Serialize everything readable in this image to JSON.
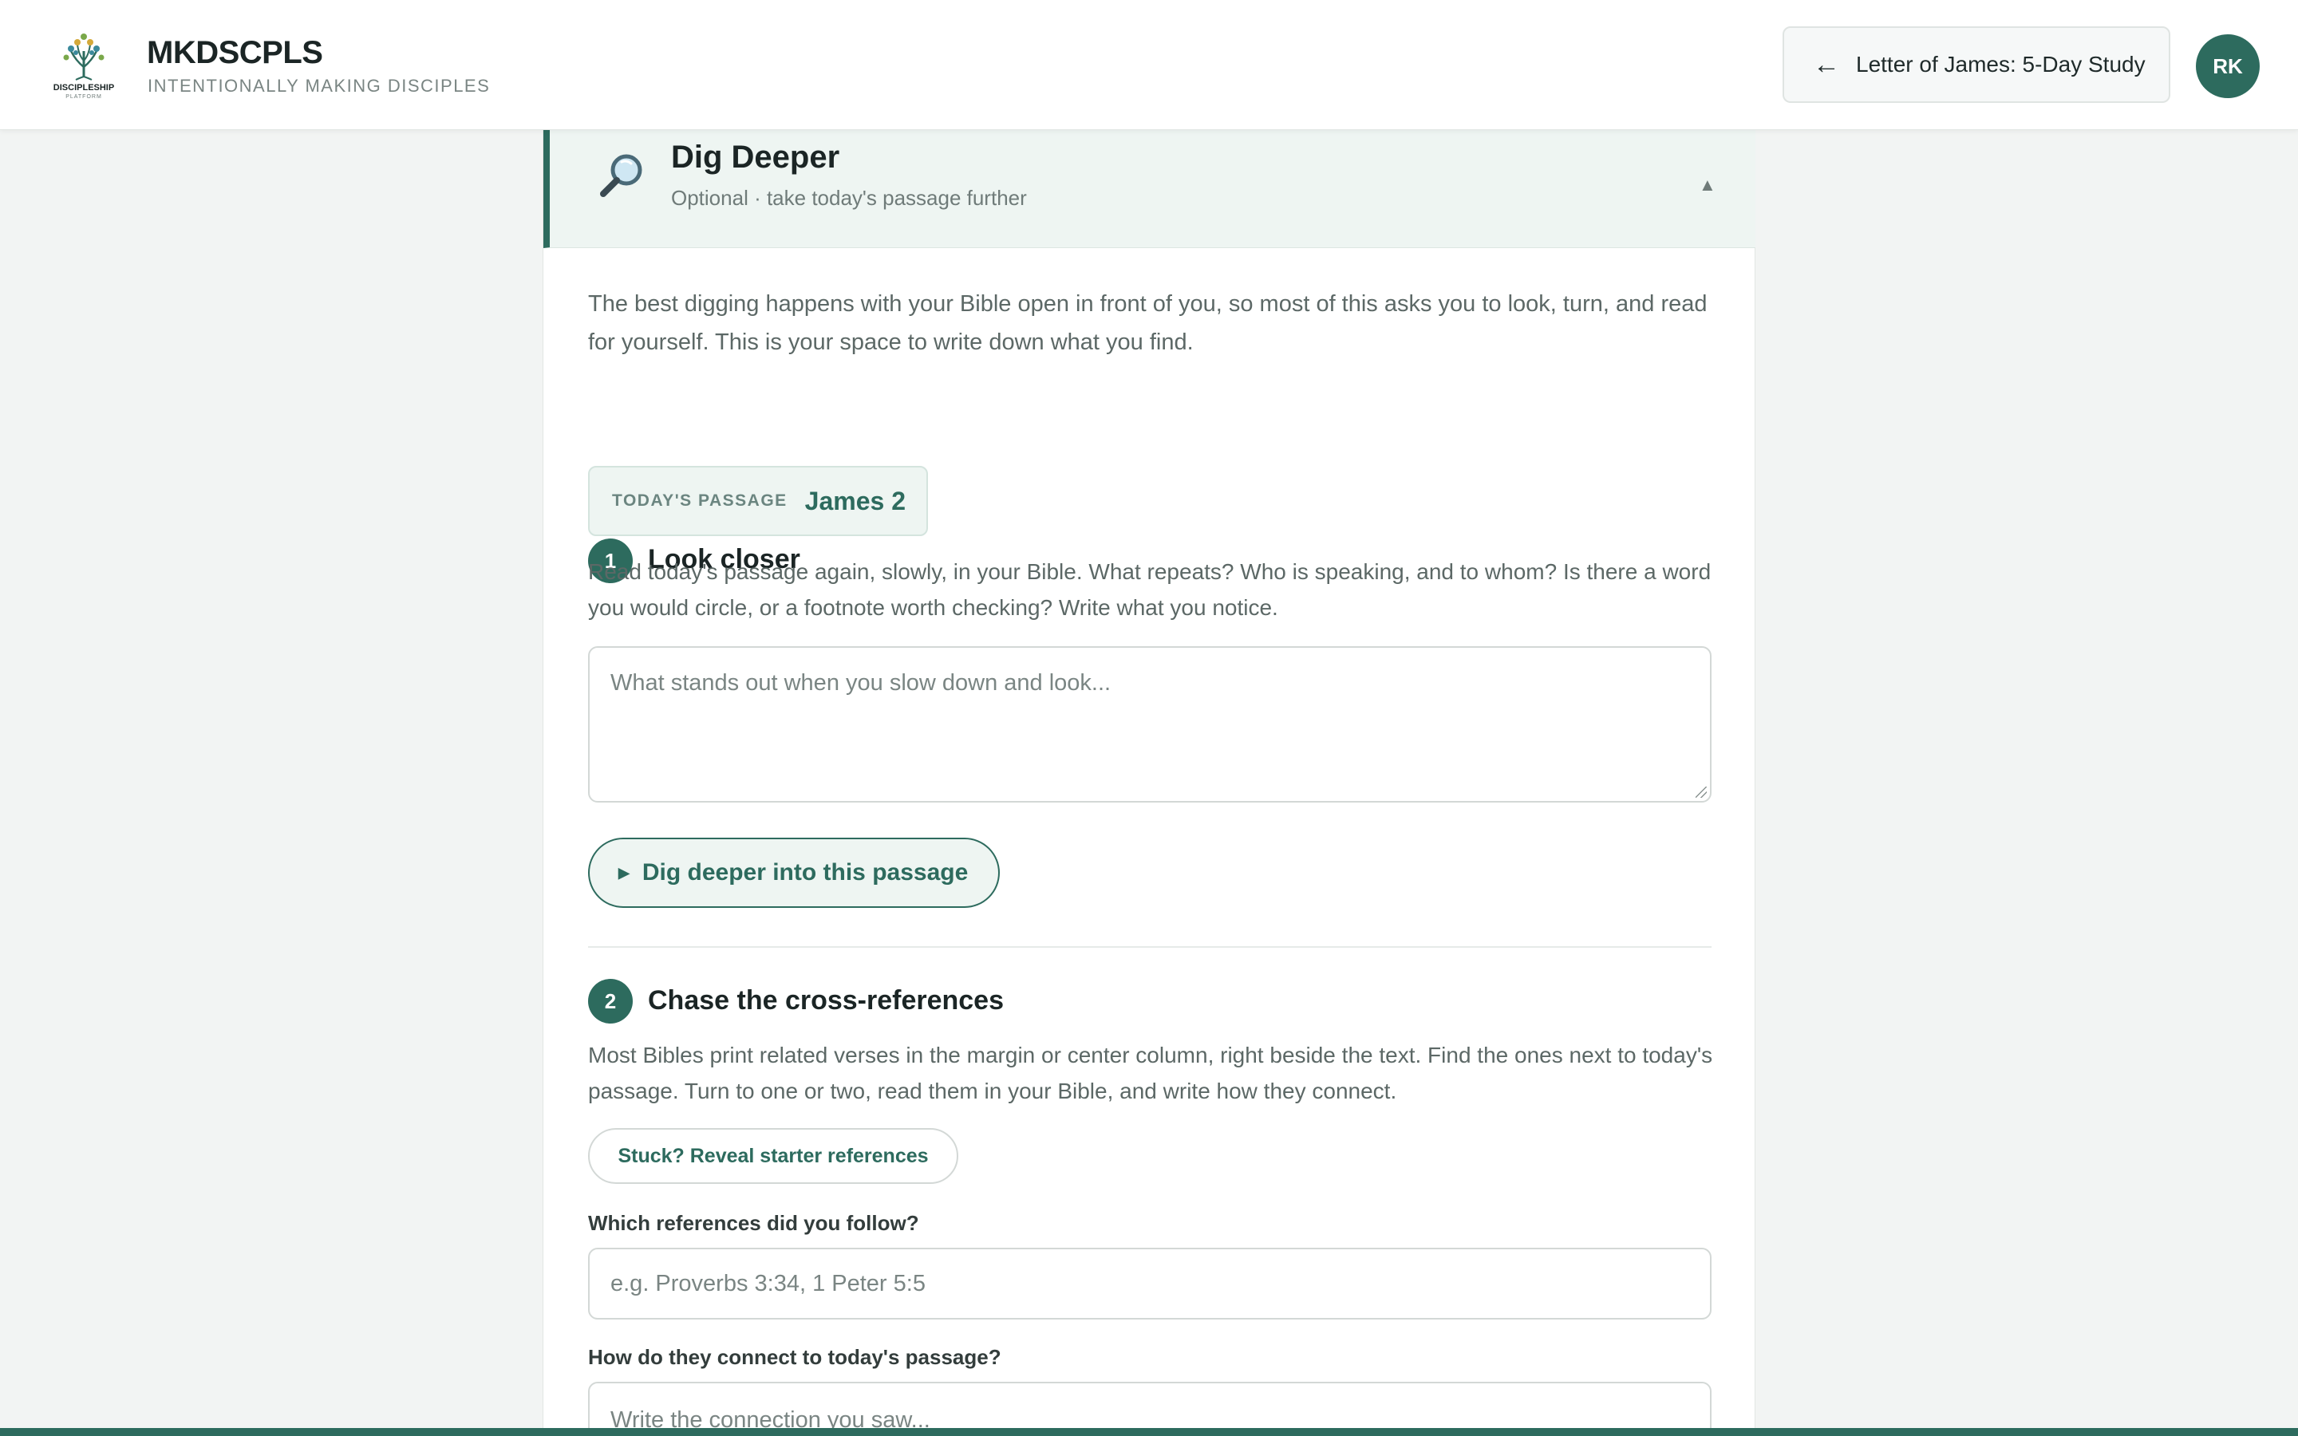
{
  "header": {
    "logo_text": "DISCIPLESHIP",
    "logo_subtext": "PLATFORM",
    "brand_name": "MKDSCPLS",
    "brand_tagline": "INTENTIONALLY MAKING DISCIPLES",
    "back_arrow": "←",
    "back_label": "Letter of James: 5-Day Study",
    "avatar_initials": "RK"
  },
  "card": {
    "title": "Dig Deeper",
    "subtitle": "Optional · take today's passage further",
    "collapse_glyph": "▲",
    "intro": "The best digging happens with your Bible open in front of you, so most of this asks you to look, turn, and read for yourself. This is your space to write down what you find."
  },
  "step1": {
    "number": "1",
    "title": "Look closer",
    "passage_label": "TODAY'S PASSAGE",
    "passage_ref": "James 2",
    "instructions": "Read today's passage again, slowly, in your Bible. What repeats? Who is speaking, and to whom? Is there a word you would circle, or a footnote worth checking? Write what you notice.",
    "notes_placeholder": "What stands out when you slow down and look...",
    "dig_button_glyph": "▶",
    "dig_button_label": "Dig deeper into this passage"
  },
  "step2": {
    "number": "2",
    "title": "Chase the cross-references",
    "instructions": "Most Bibles print related verses in the margin or center column, right beside the text. Find the ones next to today's passage. Turn to one or two, read them in your Bible, and write how they connect.",
    "reveal_label": "Stuck? Reveal starter references",
    "refs_label": "Which references did you follow?",
    "refs_placeholder": "e.g. Proverbs 3:34, 1 Peter 5:5",
    "connect_label": "How do they connect to today's passage?",
    "connect_placeholder": "Write the connection you saw..."
  },
  "colors": {
    "accent": "#2d6b5e",
    "accent_light": "#eef5f2",
    "page_bg": "#f2f4f3"
  }
}
